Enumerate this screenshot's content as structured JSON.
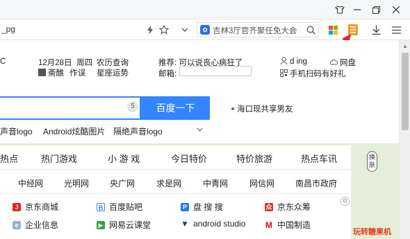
{
  "titlebar": {
    "icons": [
      "shirt-icon",
      "minimize-icon",
      "restore-icon",
      "close-icon"
    ]
  },
  "addressbar": {
    "url_fragment": "_pg",
    "search_text": "吉林3厅官齐聚任免大会",
    "icons": [
      "lightning-icon",
      "star-icon",
      "chevron-down-icon",
      "paw-icon",
      "search-icon",
      "windows-icon",
      "app-icon",
      "download-icon",
      "menu-icon"
    ]
  },
  "header": {
    "left_fragment": "C",
    "date": "12月28日",
    "weekday": "周四",
    "calendar_query": "农历查询",
    "lunar_label": "斋醮",
    "lunar_action": "作误",
    "horoscope": "星座运势",
    "recommend_label": "推荐:",
    "recommend_text": "可以说丧心病狂了",
    "mail_label": "邮箱:",
    "username": "d        ing",
    "netdisk": "网盘",
    "scan_text": "手机扫码有好礼"
  },
  "search": {
    "badge": "5",
    "button_label": "百度一下",
    "hot_topic": "海口现共享男友"
  },
  "suggestions": [
    "声音logo",
    "Android炫酷图片",
    "隔绝声音logo"
  ],
  "nav": {
    "tabs": [
      "热点",
      "热门游戏",
      "小 游 戏",
      "今日特价",
      "特价旅游",
      "热点车讯"
    ],
    "sites": [
      "中经网",
      "光明网",
      "央广网",
      "求是网",
      "中青网",
      "网信网",
      "南昌市政府"
    ]
  },
  "apps": [
    {
      "label": "京东商城",
      "icon": "jd-icon",
      "color": "#e1251b"
    },
    {
      "label": "百度贴吧",
      "icon": "tieba-icon",
      "color": "#3385ff"
    },
    {
      "label": "盘 搜 搜",
      "icon": "pansou-icon",
      "color": "#1e7be8"
    },
    {
      "label": "京东众筹",
      "icon": "jd-crowdfund-icon",
      "color": "#d9332a"
    },
    {
      "label": "企业信息",
      "icon": "enterprise-icon",
      "color": "#9ab0c8"
    },
    {
      "label": "网易云课堂",
      "icon": "netease-icon",
      "color": "#2aa748"
    },
    {
      "label": "android studio",
      "icon": "android-studio-icon",
      "color": "#1c3f6e"
    },
    {
      "label": "中国制造",
      "icon": "made-in-china-icon",
      "color": "#e60012"
    }
  ],
  "side": {
    "skin_button": "换肤",
    "promo": "玩转糖果机"
  }
}
